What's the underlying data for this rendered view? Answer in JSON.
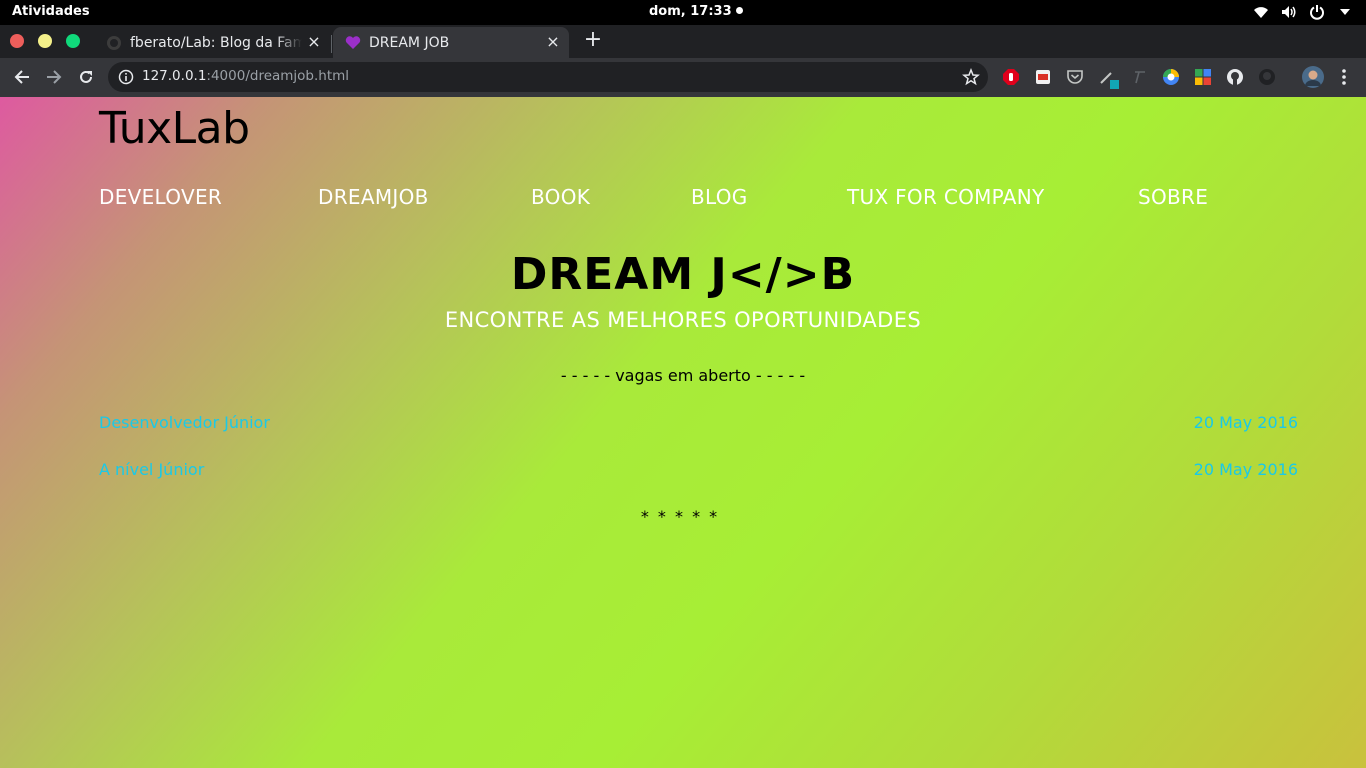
{
  "system_bar": {
    "activities": "Atividades",
    "clock": "dom, 17:33"
  },
  "browser": {
    "tabs": [
      {
        "title": "fberato/Lab: Blog da Família",
        "favicon": "github-icon",
        "active": false
      },
      {
        "title": "DREAM JOB",
        "favicon": "purple-heart-icon",
        "active": true
      }
    ],
    "address_bar": {
      "host": "127.0.0.1",
      "path": ":4000/dreamjob.html"
    },
    "extensions": [
      "adblock-icon",
      "pdf-icon",
      "pocket-icon",
      "eyedropper-icon",
      "font-icon",
      "google-icon",
      "grid-icon",
      "github-icon",
      "github-dark-icon",
      "profile-avatar"
    ]
  },
  "site": {
    "brand": "TuxLab",
    "nav": [
      "DEVELOVER",
      "DREAMJOB",
      "BOOK",
      "BLOG",
      "TUX FOR COMPANY",
      "SOBRE"
    ],
    "hero_title_prefix": "DREAM J",
    "hero_title_code": "</>",
    "hero_title_suffix": "B",
    "hero_subtitle": "ENCONTRE AS MELHORES OPORTUNIDADES",
    "section_label": "- - - - - vagas em aberto - - - - -",
    "jobs": [
      {
        "title": "Desenvolvedor Júnior",
        "date": "20 May 2016"
      },
      {
        "title": "A nível Júnior",
        "date": "20 May 2016"
      }
    ],
    "footer_dots": "* * * * *"
  },
  "colors": {
    "link": "#1ac9e8",
    "nav_text": "#ffffff",
    "gradient": [
      "#de5aa0",
      "#a7ee35",
      "#c9c13d"
    ]
  }
}
